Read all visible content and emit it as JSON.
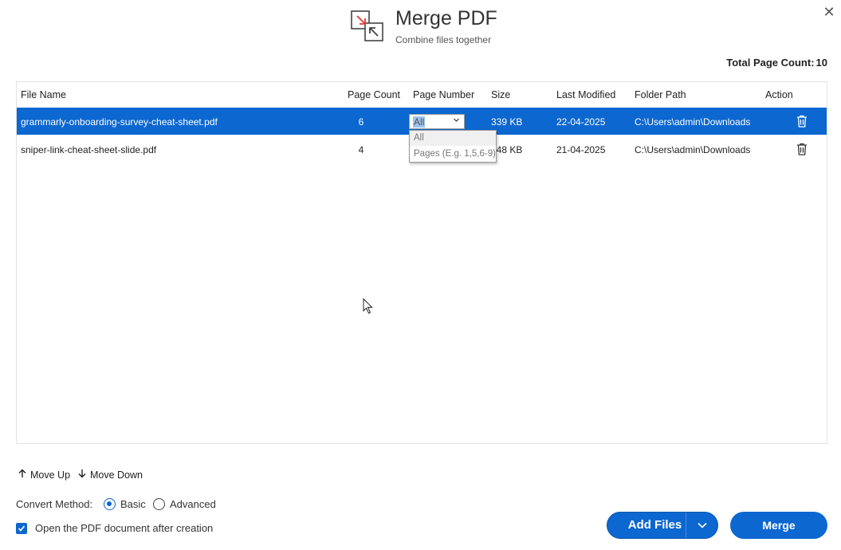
{
  "dialog": {
    "title": "Merge PDF",
    "subtitle": "Combine files together",
    "close_glyph": "✕",
    "logo_icon": "merge-arrows-icon"
  },
  "summary": {
    "total_label": "Total Page Count:",
    "total_value": "10"
  },
  "table": {
    "columns": [
      "File Name",
      "Page Count",
      "Page Number",
      "Size",
      "Last Modified",
      "Folder Path",
      "Action"
    ],
    "rows": [
      {
        "file_name": "grammarly-onboarding-survey-cheat-sheet.pdf",
        "page_count": "6",
        "page_number": "All",
        "size": "339 KB",
        "last_modified": "22-04-2025",
        "folder_path": "C:\\Users\\admin\\Downloads",
        "selected": true
      },
      {
        "file_name": "sniper-link-cheat-sheet-slide.pdf",
        "page_count": "4",
        "page_number": "All",
        "size": "148 KB",
        "last_modified": "21-04-2025",
        "folder_path": "C:\\Users\\admin\\Downloads",
        "selected": false
      }
    ],
    "page_number_options": [
      "All",
      "Pages (E.g. 1,5,6-9)"
    ]
  },
  "controls": {
    "move_up": "Move Up",
    "move_down": "Move Down",
    "convert_method_label": "Convert Method:",
    "method_basic": "Basic",
    "method_advanced": "Advanced",
    "selected_method": "Basic",
    "open_after_label": "Open the PDF document after creation",
    "open_after_checked": true,
    "add_files": "Add Files",
    "merge": "Merge"
  },
  "colors": {
    "accent": "#0c67d0",
    "logo_arrow": "#e8382f"
  }
}
